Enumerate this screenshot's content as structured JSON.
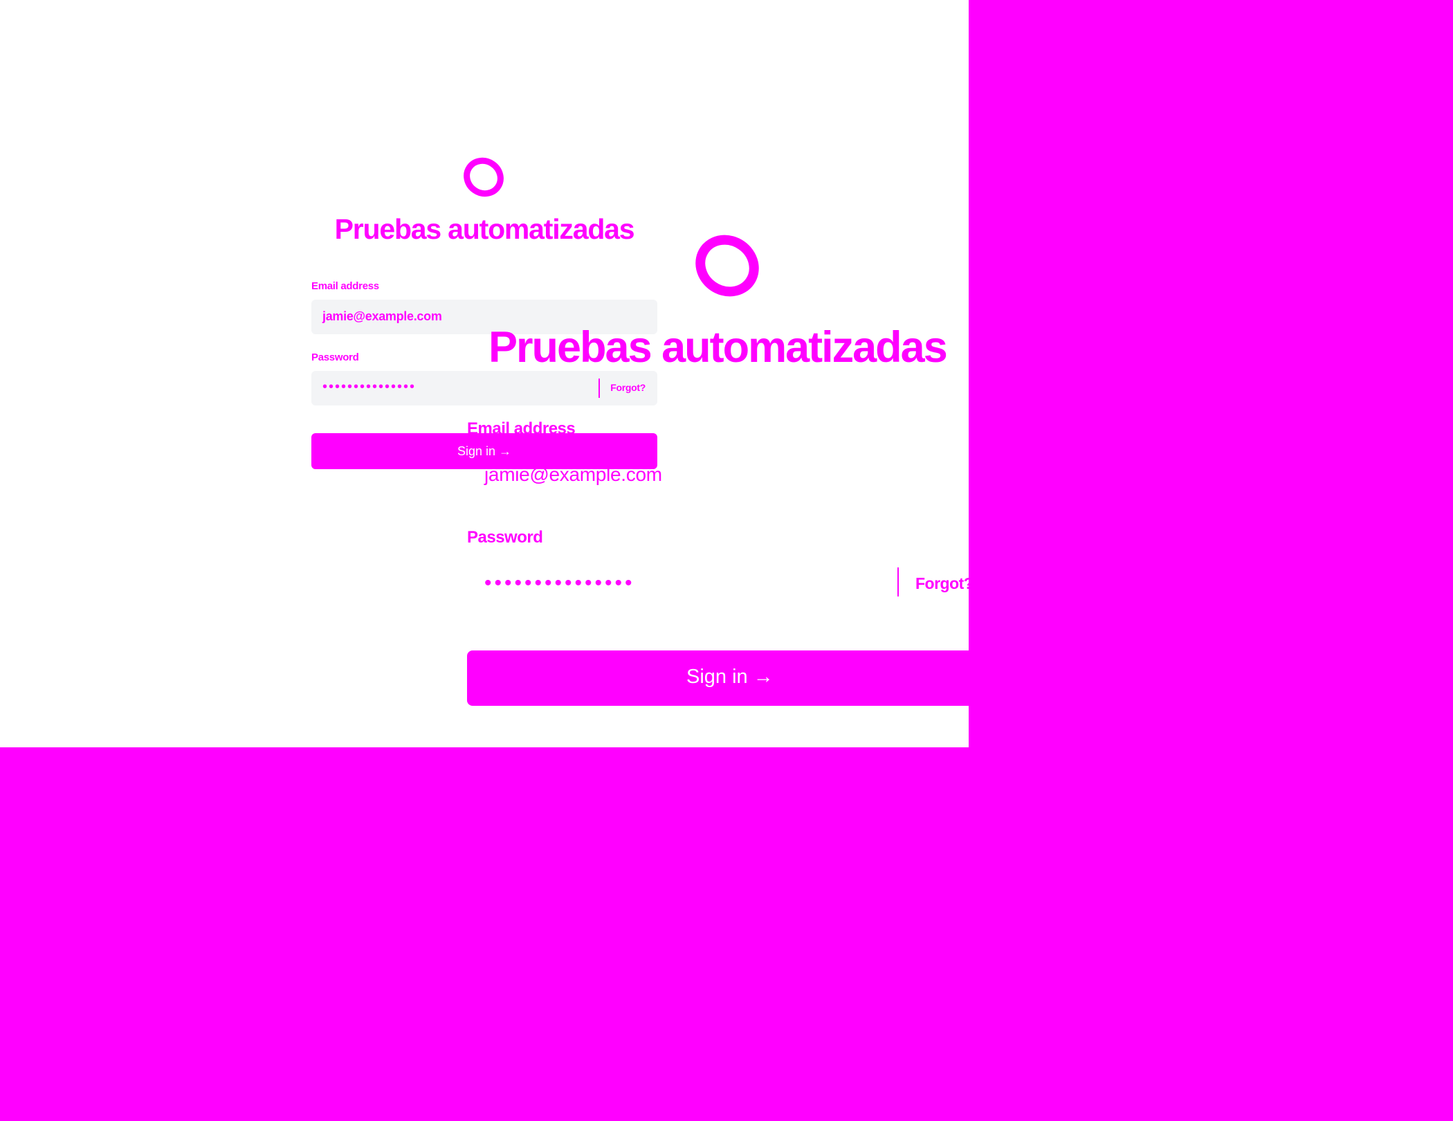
{
  "app": {
    "title": "Pruebas automatizadas"
  },
  "login_small": {
    "email_label": "Email address",
    "email_value": "jamie@example.com",
    "password_label": "Password",
    "password_mask": "•••••••••••••••",
    "forgot_label": "Forgot?",
    "sign_in_label": "Sign in →"
  },
  "login_large": {
    "email_label": "Email address",
    "email_value": "jamie@example.com",
    "password_label": "Password",
    "password_mask": "•••••••••••••••",
    "forgot_label": "Forgot?",
    "sign_in_label": "Sign in →"
  },
  "icons": {
    "logo": "ring-logo-icon"
  },
  "colors": {
    "accent": "#ff00ff",
    "background": "#ffffff",
    "field_background": "#f3f4f6"
  }
}
